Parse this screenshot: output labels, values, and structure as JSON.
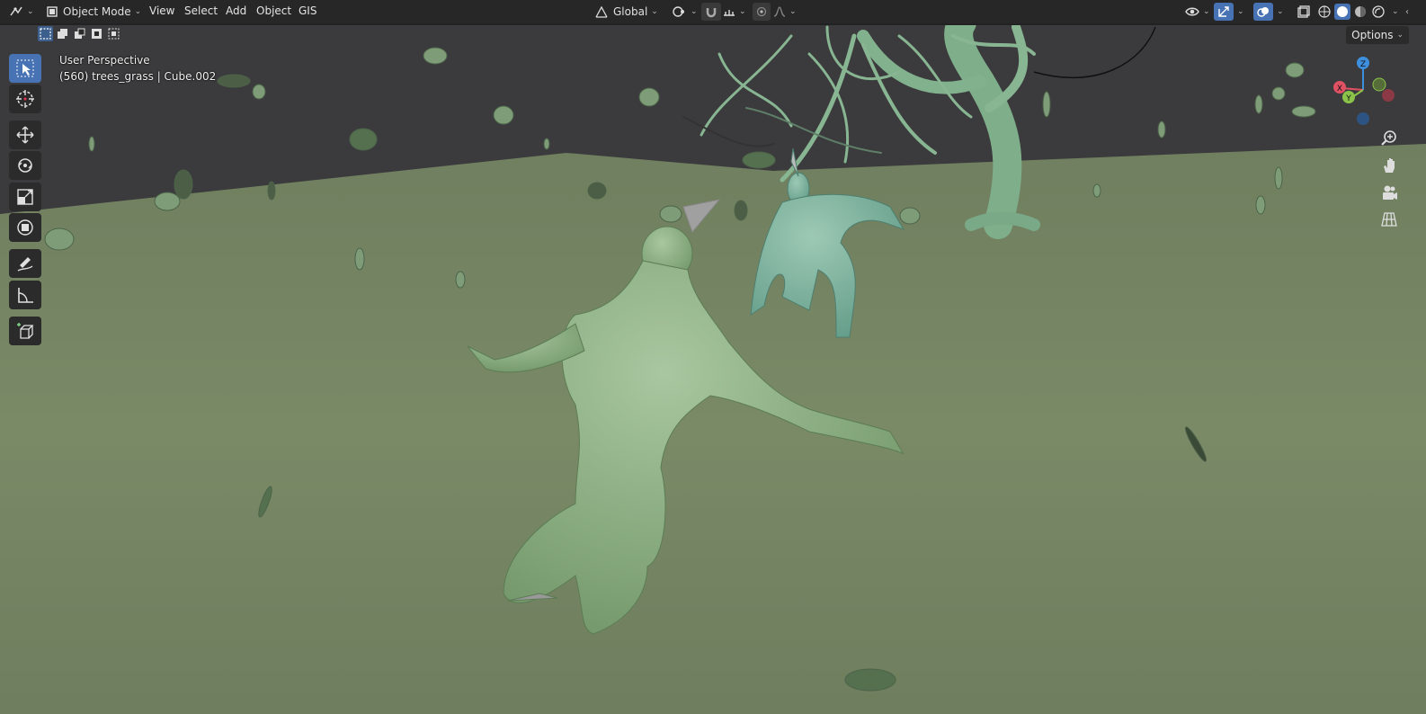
{
  "header": {
    "mode_label": "Object Mode",
    "menus": [
      "View",
      "Select",
      "Add",
      "Object",
      "GIS"
    ],
    "orientation_label": "Global",
    "options_label": "Options"
  },
  "viewport": {
    "view_name": "User Perspective",
    "object_info": "(560) trees_grass | Cube.002"
  },
  "gizmo": {
    "x": "X",
    "y": "Y",
    "z": "Z"
  },
  "colors": {
    "header_bg": "#282828",
    "active_blue": "#4772b3",
    "ground": "#738563",
    "sky": "#3a3a3c",
    "model": "#8fb28a",
    "axis_x": "#e05263",
    "axis_y": "#8bc34a",
    "axis_z": "#3f8fdf"
  },
  "icons": {
    "editor_type": "editor-type-icon",
    "mode": "object-mode-icon",
    "transform_pivot": "pivot-icon",
    "snap": "snap-magnet-icon",
    "proportional": "proportional-edit-icon",
    "visibility": "eye-icon",
    "gizmo": "gizmo-toggle-icon",
    "overlays": "overlays-icon",
    "xray": "xray-icon",
    "tools": [
      "select-box-icon",
      "cursor-icon",
      "move-icon",
      "rotate-icon",
      "scale-icon",
      "transform-icon",
      "annotate-icon",
      "measure-icon",
      "add-cube-icon"
    ],
    "nav": [
      "zoom-icon",
      "pan-hand-icon",
      "camera-icon",
      "grid-view-icon"
    ]
  }
}
